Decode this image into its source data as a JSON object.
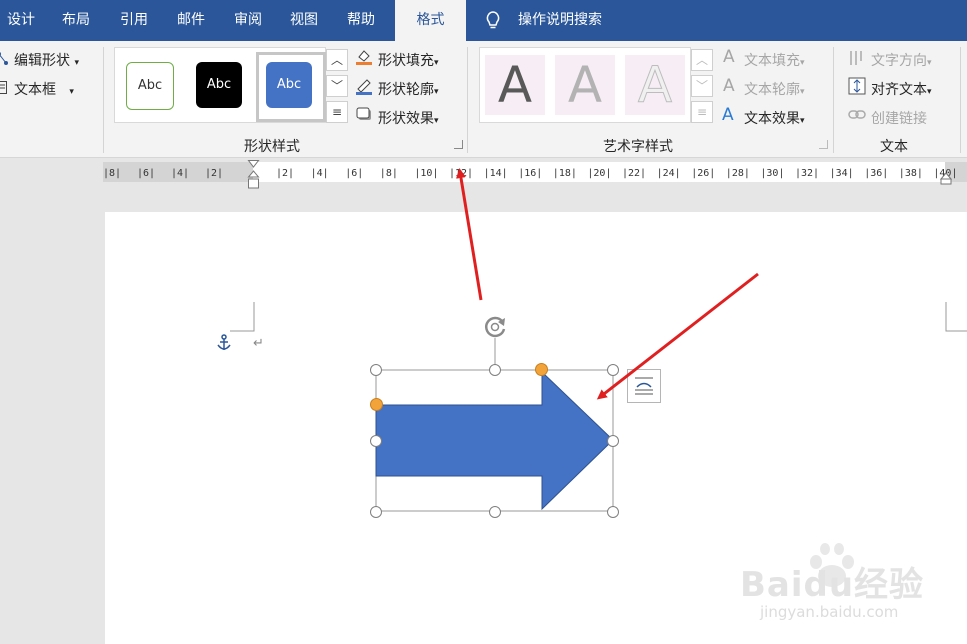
{
  "tabs": [
    {
      "label": "设计"
    },
    {
      "label": "布局"
    },
    {
      "label": "引用"
    },
    {
      "label": "邮件"
    },
    {
      "label": "审阅"
    },
    {
      "label": "视图"
    },
    {
      "label": "帮助"
    },
    {
      "label": "格式"
    },
    {
      "label": "操作说明搜索"
    }
  ],
  "ribbon": {
    "insert": {
      "edit_shape": "编辑形状",
      "text_box": "文本框"
    },
    "shape_styles": {
      "label": "形状样式",
      "swatches": [
        "Abc",
        "Abc",
        "Abc"
      ],
      "fill": "形状填充",
      "outline": "形状轮廓",
      "effects": "形状效果"
    },
    "wordart": {
      "label": "艺术字样式",
      "letters": [
        "A",
        "A",
        "A"
      ],
      "text_fill": "文本填充",
      "text_outline": "文本轮廓",
      "text_effects": "文本效果"
    },
    "text": {
      "label": "文本",
      "direction": "文字方向",
      "align": "对齐文本",
      "link": "创建链接"
    }
  },
  "ruler": {
    "left_ticks": [
      "8",
      "6",
      "4",
      "2"
    ],
    "right_ticks": [
      "2",
      "4",
      "6",
      "8",
      "10",
      "12",
      "14",
      "16",
      "18",
      "20",
      "22",
      "24",
      "26",
      "28",
      "30",
      "32",
      "34",
      "36",
      "38",
      "40"
    ]
  },
  "colors": {
    "tabbar": "#2b579a",
    "shape_fill": "#4472c4",
    "shape_border": "#2f528f",
    "annotation_arrow": "#e02020",
    "adjust_handle": "#f2a33a"
  },
  "watermark": {
    "brand": "Baidu经验",
    "url": "jingyan.baidu.com"
  }
}
